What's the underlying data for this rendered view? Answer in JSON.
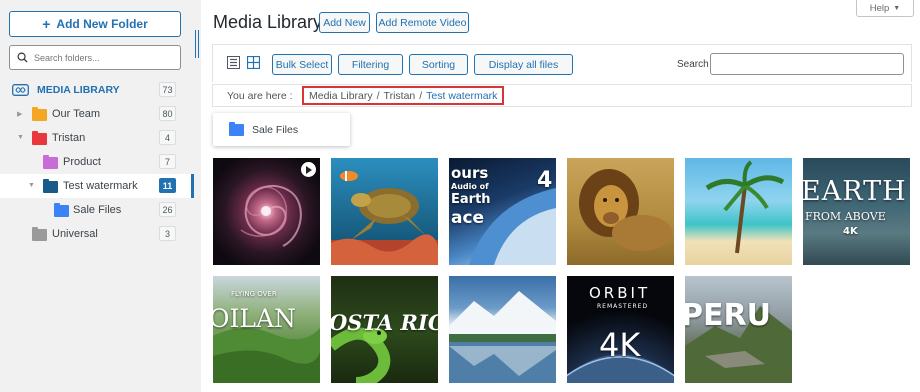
{
  "sidebar": {
    "add_folder_label": "Add New Folder",
    "search_placeholder": "Search folders...",
    "library": {
      "label": "MEDIA LIBRARY",
      "count": "73"
    },
    "items": [
      {
        "label": "Our Team",
        "count": "80",
        "color": "#f5a623"
      },
      {
        "label": "Tristan",
        "count": "4",
        "color": "#e8383d"
      },
      {
        "label": "Product",
        "count": "7",
        "color": "#c86dd7"
      },
      {
        "label": "Test watermark",
        "count": "11",
        "color": "#1a5a8a"
      },
      {
        "label": "Sale Files",
        "count": "26",
        "color": "#3b82f6"
      },
      {
        "label": "Universal",
        "count": "3",
        "color": "#9a9a9a"
      }
    ]
  },
  "header": {
    "title": "Media Library",
    "add_new": "Add New",
    "add_remote_video": "Add Remote Video",
    "help": "Help"
  },
  "toolbar": {
    "bulk_select": "Bulk Select",
    "filtering": "Filtering",
    "sorting": "Sorting",
    "display_all": "Display all files",
    "search_label": "Search"
  },
  "breadcrumb": {
    "prefix": "You are here",
    "sep": ":",
    "items": [
      "Media Library",
      "Tristan",
      "Test watermark"
    ],
    "divider": "/"
  },
  "subfolder": {
    "label": "Sale Files"
  },
  "tiles": [
    {
      "name": "galaxy",
      "text": ""
    },
    {
      "name": "sea-turtle",
      "text": ""
    },
    {
      "name": "earth-from-space",
      "text1": "ours",
      "text2": "Audio of",
      "text3": "Earth",
      "text4": "ace",
      "text5": "4"
    },
    {
      "name": "lion",
      "text": ""
    },
    {
      "name": "beach-palm",
      "text": ""
    },
    {
      "name": "earth-from-above",
      "text1": "EARTH",
      "text2": "FROM ABOVE",
      "text3": "4K"
    },
    {
      "name": "flying-over-ireland",
      "text1": "FLYING OVER",
      "text2": "OILAN"
    },
    {
      "name": "costa-rica",
      "text1": "OSTA RICA"
    },
    {
      "name": "mountain-lake",
      "text": ""
    },
    {
      "name": "orbit",
      "text1": "ORBIT",
      "text2": "REMASTERED",
      "text3": "4K"
    },
    {
      "name": "peru",
      "text1": "PERU"
    }
  ]
}
